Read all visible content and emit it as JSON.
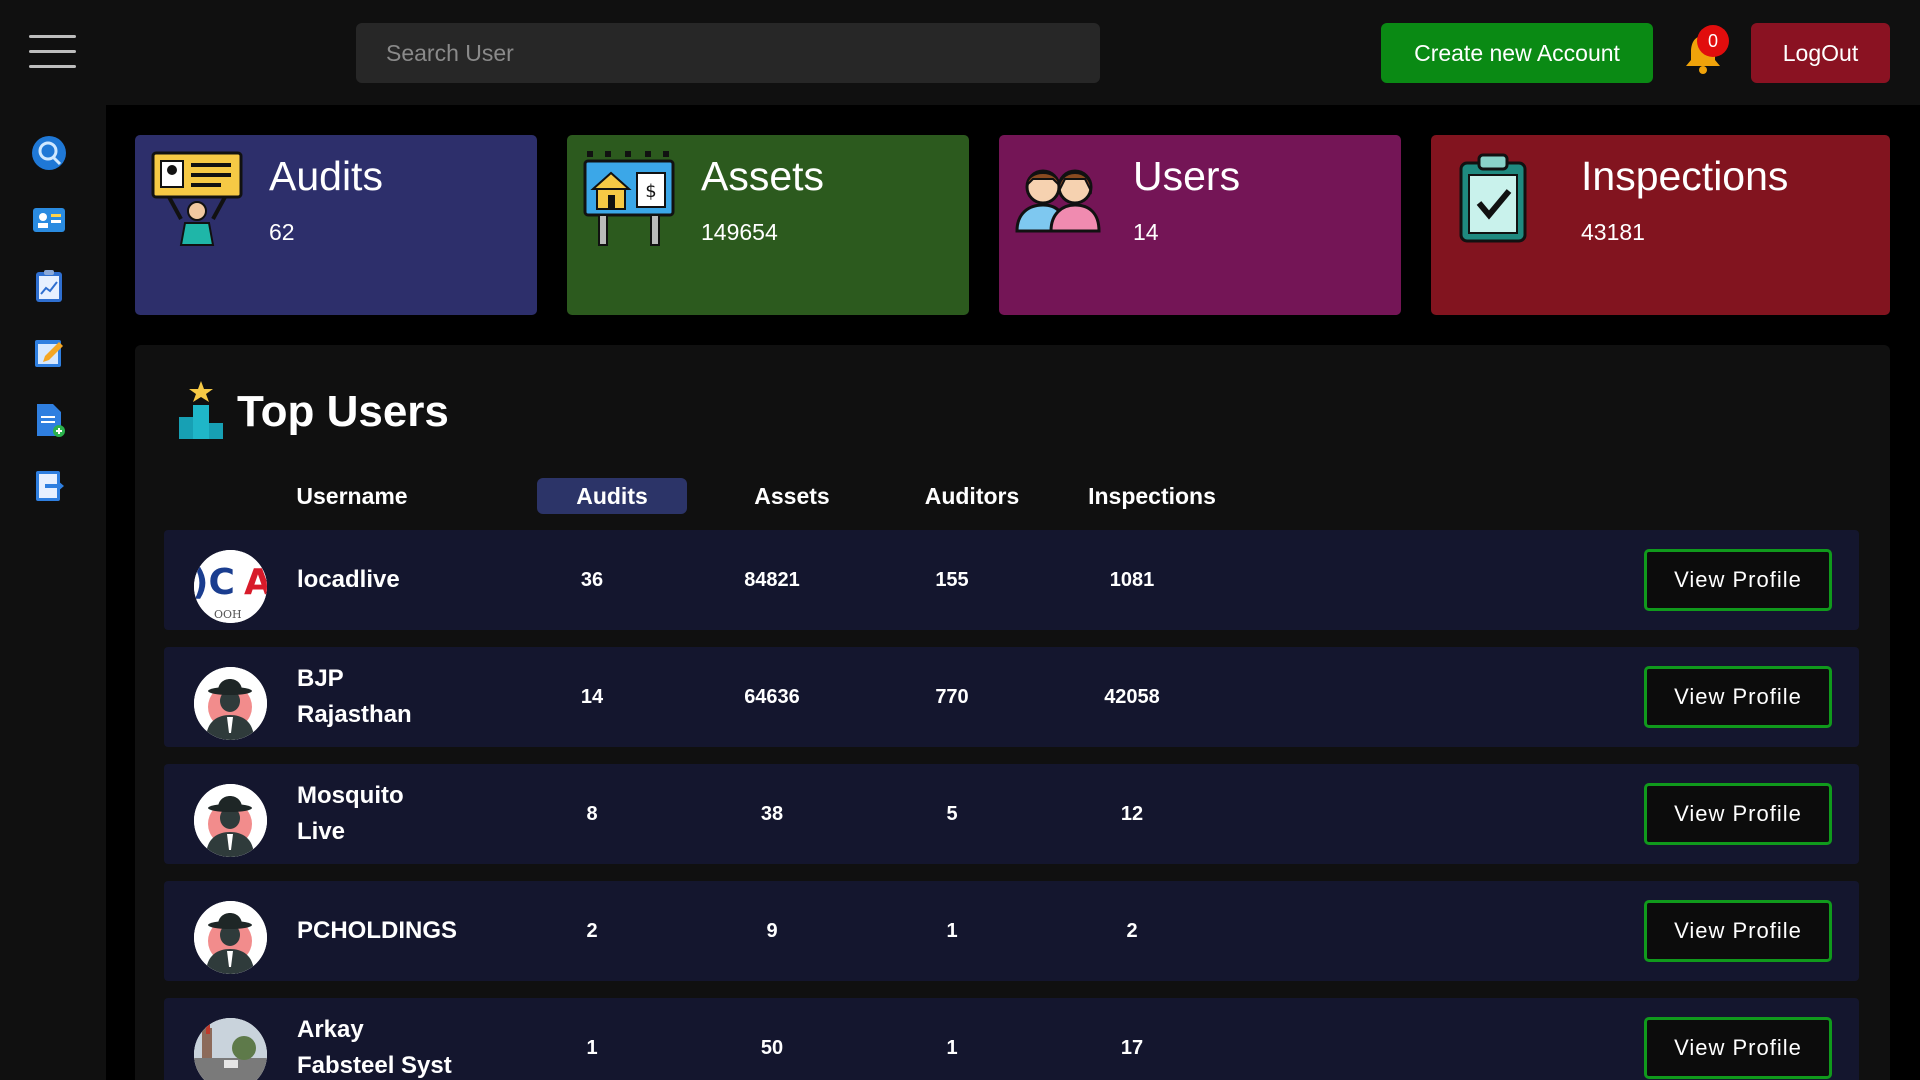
{
  "header": {
    "search_placeholder": "Search User",
    "create_label": "Create new Account",
    "notification_count": "0",
    "logout_label": "LogOut"
  },
  "sidebar": {
    "icons": [
      "search-icon",
      "dashboard-card-icon",
      "clipboard-chart-icon",
      "edit-note-icon",
      "add-document-icon",
      "exit-document-icon"
    ]
  },
  "stats": [
    {
      "title": "Audits",
      "value": "62",
      "color": "#2d2f6b",
      "icon": "auditor-sign-icon"
    },
    {
      "title": "Assets",
      "value": "149654",
      "color": "#2c5a1e",
      "icon": "billboard-icon"
    },
    {
      "title": "Users",
      "value": "14",
      "color": "#741556",
      "icon": "users-group-icon"
    },
    {
      "title": "Inspections",
      "value": "43181",
      "color": "#82141f",
      "icon": "clipboard-check-icon"
    }
  ],
  "top_users": {
    "title": "Top Users",
    "columns": [
      "Username",
      "Audits",
      "Assets",
      "Auditors",
      "Inspections"
    ],
    "view_label": "View Profile",
    "rows": [
      {
        "username": "locadlive",
        "audits": "36",
        "assets": "84821",
        "auditors": "155",
        "inspections": "1081",
        "avatar": "logo-avatar"
      },
      {
        "username": "BJP Rajasthan",
        "audits": "14",
        "assets": "64636",
        "auditors": "770",
        "inspections": "42058",
        "avatar": "spy-avatar"
      },
      {
        "username": "Mosquito Live",
        "audits": "8",
        "assets": "38",
        "auditors": "5",
        "inspections": "12",
        "avatar": "spy-avatar"
      },
      {
        "username": "PCHOLDINGS",
        "audits": "2",
        "assets": "9",
        "auditors": "1",
        "inspections": "2",
        "avatar": "spy-avatar"
      },
      {
        "username": "Arkay Fabsteel Syst",
        "audits": "1",
        "assets": "50",
        "auditors": "1",
        "inspections": "17",
        "avatar": "street-photo-avatar"
      }
    ]
  }
}
